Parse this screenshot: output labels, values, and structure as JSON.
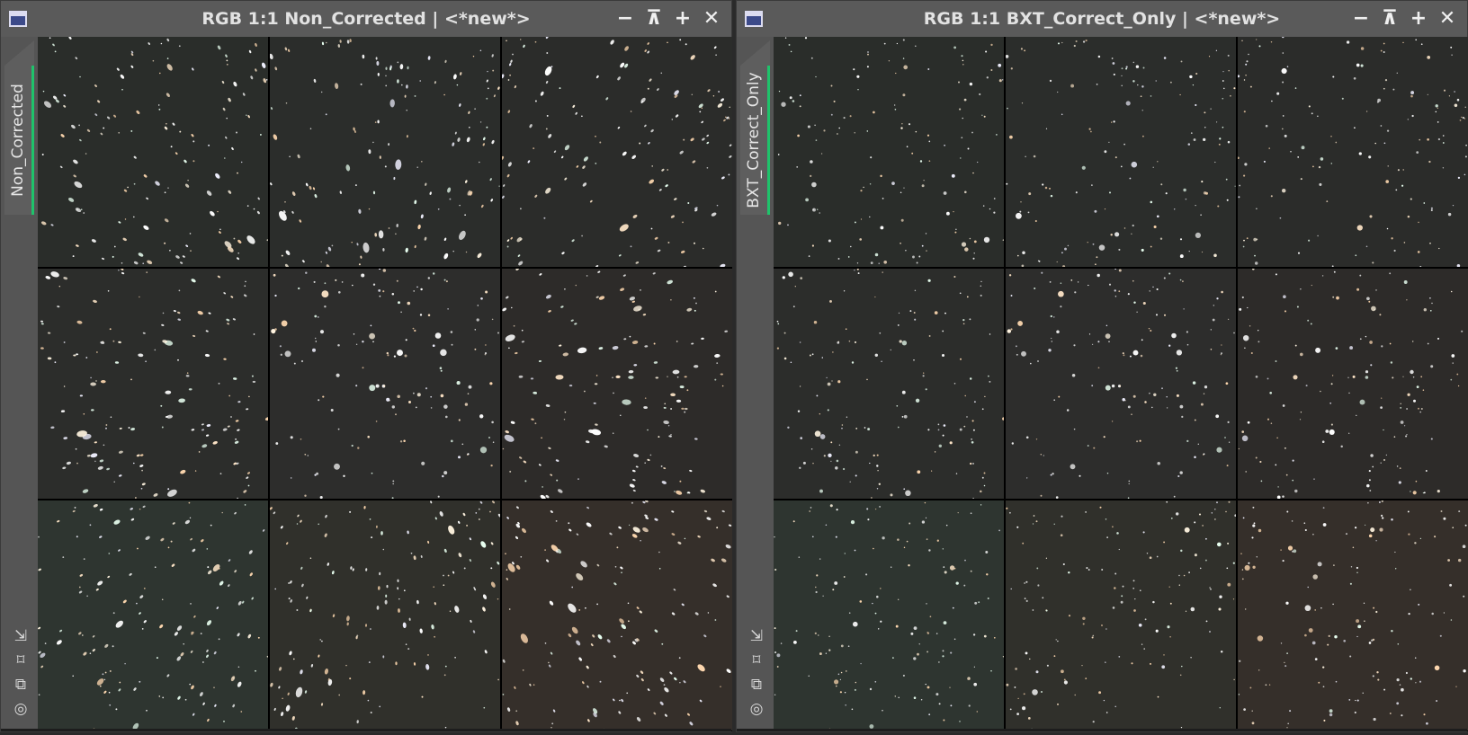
{
  "windows": [
    {
      "title": "RGB 1:1 Non_Corrected | <*new*>",
      "tab_label": "Non_Corrected",
      "variant": "uncorrected"
    },
    {
      "title": "RGB 1:1 BXT_Correct_Only | <*new*>",
      "tab_label": "BXT_Correct_Only",
      "variant": "corrected"
    }
  ],
  "title_buttons": [
    {
      "name": "minimize-icon",
      "glyph": "−"
    },
    {
      "name": "shade-icon",
      "glyph": "⊼"
    },
    {
      "name": "maximize-icon",
      "glyph": "+"
    },
    {
      "name": "close-icon",
      "glyph": "✕"
    }
  ],
  "side_tools": [
    {
      "name": "resize-arrow-icon",
      "glyph": "⇲"
    },
    {
      "name": "fit-view-icon",
      "glyph": "⌑"
    },
    {
      "name": "clone-view-icon",
      "glyph": "⧉"
    },
    {
      "name": "target-icon",
      "glyph": "◎"
    }
  ],
  "mosaic": {
    "rows": 3,
    "cols": 3,
    "panel_tints": [
      "#2a2d2a",
      "#2b2d2b",
      "#2b2c2a",
      "#2c2d2b",
      "#2d2d2c",
      "#2d2b29",
      "#2e3530",
      "#30302b",
      "#352f2a"
    ]
  }
}
